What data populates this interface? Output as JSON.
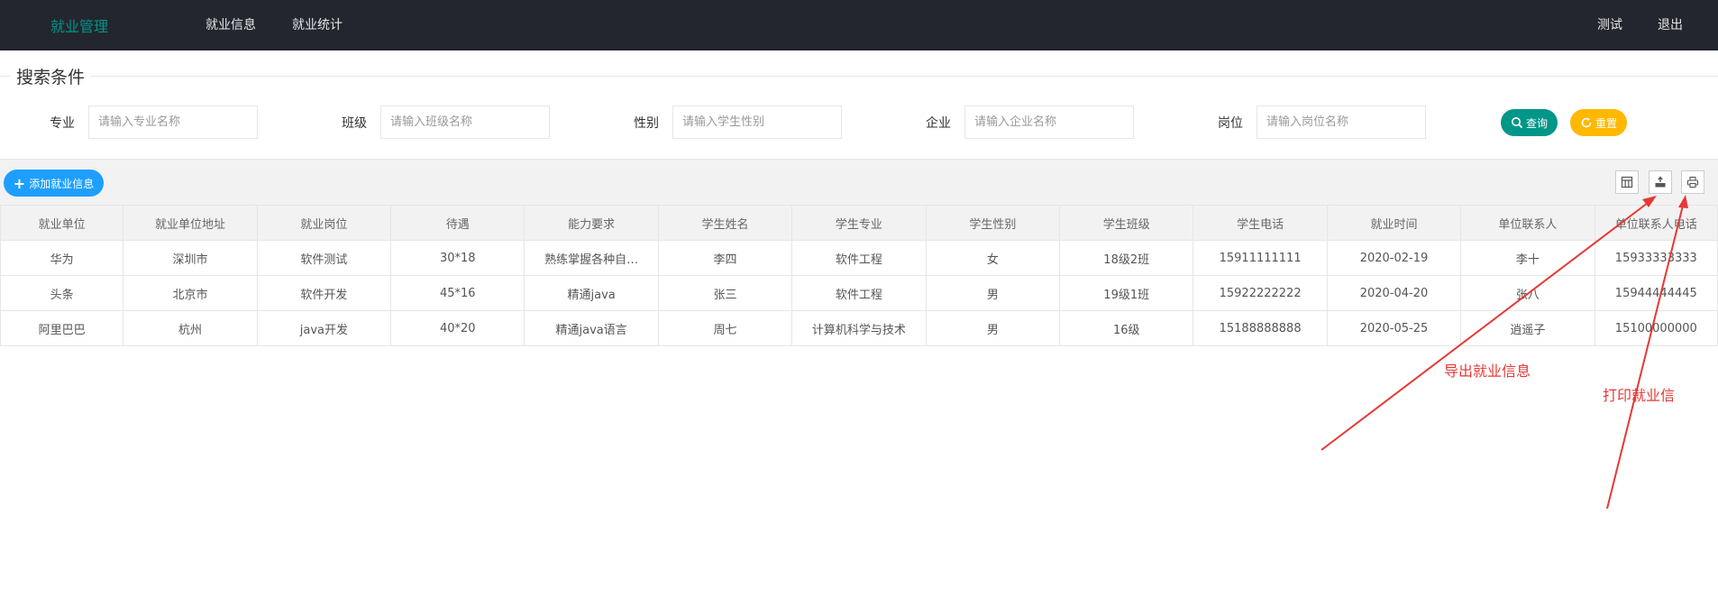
{
  "header": {
    "logo": "就业管理",
    "nav": [
      "就业信息",
      "就业统计"
    ],
    "right": [
      "测试",
      "退出"
    ]
  },
  "search": {
    "legend": "搜索条件",
    "fields": [
      {
        "label": "专业",
        "placeholder": "请输入专业名称"
      },
      {
        "label": "班级",
        "placeholder": "请输入班级名称"
      },
      {
        "label": "性别",
        "placeholder": "请输入学生性别"
      },
      {
        "label": "企业",
        "placeholder": "请输入企业名称"
      },
      {
        "label": "岗位",
        "placeholder": "请输入岗位名称"
      }
    ],
    "query_label": "查询",
    "reset_label": "重置"
  },
  "toolbar": {
    "add_label": "添加就业信息",
    "icons": [
      "columns-icon",
      "export-icon",
      "print-icon"
    ]
  },
  "table": {
    "columns": [
      "就业单位",
      "就业单位地址",
      "就业岗位",
      "待遇",
      "能力要求",
      "学生姓名",
      "学生专业",
      "学生性别",
      "学生班级",
      "学生电话",
      "就业时间",
      "单位联系人",
      "单位联系人电话"
    ],
    "rows": [
      [
        "华为",
        "深圳市",
        "软件测试",
        "30*18",
        "熟练掌握各种自…",
        "李四",
        "软件工程",
        "女",
        "18级2班",
        "15911111111",
        "2020-02-19",
        "李十",
        "15933333333"
      ],
      [
        "头条",
        "北京市",
        "软件开发",
        "45*16",
        "精通java",
        "张三",
        "软件工程",
        "男",
        "19级1班",
        "15922222222",
        "2020-04-20",
        "张八",
        "15944444445"
      ],
      [
        "阿里巴巴",
        "杭州",
        "java开发",
        "40*20",
        "精通java语言",
        "周七",
        "计算机科学与技术",
        "男",
        "16级",
        "15188888888",
        "2020-05-25",
        "逍遥子",
        "15100000000"
      ]
    ]
  },
  "annotations": {
    "export": "导出就业信息",
    "print": "打印就业信",
    "color": "#e53935"
  },
  "colors": {
    "header_bg": "#23262e",
    "logo": "#009688",
    "query": "#009688",
    "reset": "#ffb800",
    "add": "#1e9fff"
  }
}
